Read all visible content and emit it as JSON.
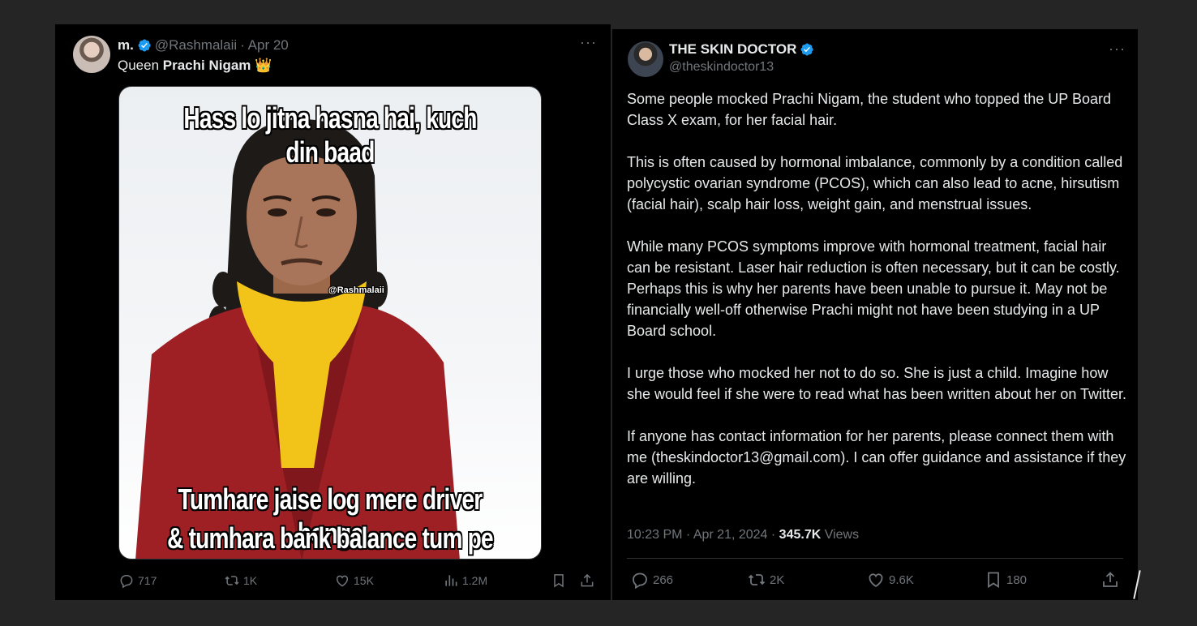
{
  "left_tweet": {
    "display_name": "m.",
    "handle": "@Rashmalaii",
    "date": "· Apr 20",
    "text_prefix": "Queen ",
    "text_bold": "Prachi Nigam",
    "crown_emoji": "👑",
    "meme": {
      "caption_top": "Hass lo jitna hasna hai, kuch din baad",
      "caption_bottom_1": "Tumhare jaise log mere driver honge",
      "caption_bottom_2": "& tumhara bank balance tum pe hasega",
      "watermark": "@Rashmalaii"
    },
    "actions": {
      "replies": "717",
      "retweets": "1K",
      "likes": "15K",
      "views": "1.2M"
    }
  },
  "right_tweet": {
    "display_name": "THE SKIN DOCTOR",
    "handle": "@theskindoctor13",
    "paragraphs": [
      "Some people mocked Prachi Nigam, the student who topped the UP Board Class X exam, for her facial hair.",
      "This is often caused by hormonal imbalance, commonly by a condition called polycystic ovarian syndrome (PCOS), which can also lead to acne, hirsutism (facial hair), scalp hair loss, weight gain, and menstrual issues.",
      "While many PCOS symptoms improve with hormonal treatment, facial hair can be resistant. Laser hair reduction is often necessary, but it can be costly. Perhaps this is why her parents have been unable to pursue it. May not be financially well-off otherwise Prachi might not have been studying in a UP Board school.",
      "I urge those who mocked her not to do so. She is just a child. Imagine how she would feel if she were to read what has been written about her on Twitter.",
      "If anyone has contact information for her parents, please connect them with me (theskindoctor13@gmail.com). I can offer guidance and assistance if they are willing."
    ],
    "timestamp": "10:23 PM · Apr 21, 2024 · ",
    "views_count": "345.7K",
    "views_label": " Views",
    "actions": {
      "replies": "266",
      "retweets": "2K",
      "likes": "9.6K",
      "bookmarks": "180"
    }
  },
  "icons": {
    "more": "more-dots-icon",
    "verified": "verified-badge-icon",
    "reply": "reply-icon",
    "retweet": "retweet-icon",
    "like": "heart-icon",
    "views": "views-chart-icon",
    "bookmark": "bookmark-icon",
    "share": "share-icon"
  },
  "colors": {
    "verified_blue": "#1d9bf0",
    "muted": "#71767b",
    "text": "#e7e9ea"
  }
}
